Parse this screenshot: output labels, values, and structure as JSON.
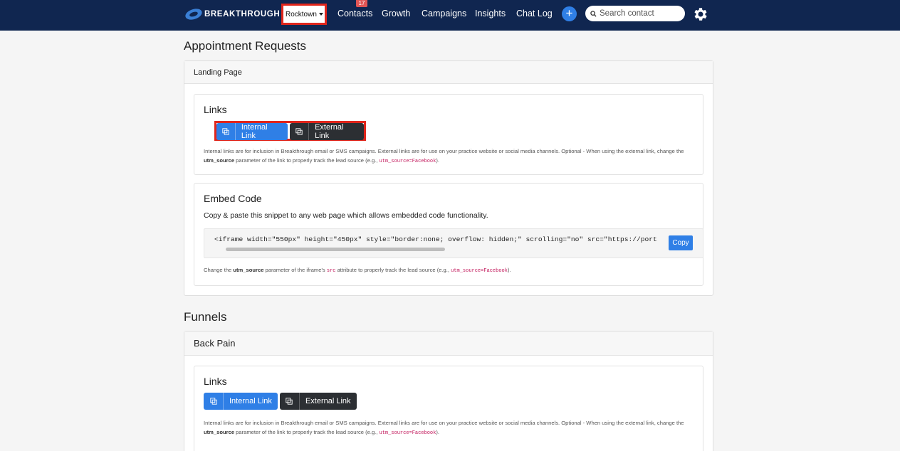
{
  "brand": {
    "name": "BREAKTHROUGH",
    "color": "#102650",
    "accent": "#2f7fe6",
    "highlight": "#e0261c"
  },
  "nav": {
    "location": "Rocktown",
    "contacts_badge": "17",
    "links": [
      "Contacts",
      "Growth",
      "Campaigns",
      "Insights",
      "Chat Log"
    ],
    "search_placeholder": "Search contact"
  },
  "appointment": {
    "title": "Appointment Requests",
    "card_header": "Landing Page",
    "links_title": "Links",
    "internal_label": "Internal Link",
    "external_label": "External Link",
    "links_help": {
      "p1": "Internal links are for inclusion in Breakthrough email or SMS campaigns. External links are for use on your practice website or social media channels. Optional - When using the external link, change the ",
      "b": "utm_source",
      "p2": " parameter of the link to properly track the lead source (e.g., ",
      "code": "utm_source=Facebook",
      "p3": ")."
    },
    "embed_title": "Embed Code",
    "embed_desc": "Copy & paste this snippet to any web page which allows embedded code functionality.",
    "embed_code": "<iframe width=\"550px\" height=\"450px\" style=\"border:none; overflow: hidden;\" scrolling=\"no\" src=\"https://portal",
    "copy_label": "Copy",
    "embed_help": {
      "p1": "Change the ",
      "b": "utm_source",
      "p2": " parameter of the iframe's ",
      "code1": "src",
      "p3": " attribute to properly track the lead source (e.g., ",
      "code2": "utm_source=Facebook",
      "p4": ")."
    }
  },
  "funnels": {
    "title": "Funnels",
    "card_header": "Back Pain",
    "links_title": "Links",
    "internal_label": "Internal Link",
    "external_label": "External Link",
    "links_help": {
      "p1": "Internal links are for inclusion in Breakthrough email or SMS campaigns. External links are for use on your practice website or social media channels. Optional - When using the external link, change the ",
      "b": "utm_source",
      "p2": " parameter of the link to properly track the lead source (e.g., ",
      "code": "utm_source=Facebook",
      "p3": ")."
    }
  }
}
